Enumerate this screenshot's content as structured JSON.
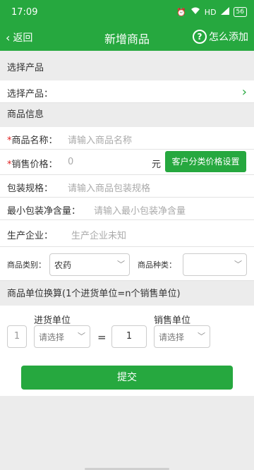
{
  "status_bar": {
    "time": "17:09",
    "net": "HD",
    "battery": "56"
  },
  "header": {
    "back_label": "返回",
    "title": "新增商品",
    "help_label": "怎么添加"
  },
  "sections": {
    "select_product": "选择产品",
    "product_info": "商品信息",
    "unit_conversion": "商品单位换算(1个进货单位=n个销售单位)"
  },
  "select_product_row": {
    "label": "选择产品："
  },
  "fields": {
    "name": {
      "required": "*",
      "label": "商品名称：",
      "placeholder": "请输入商品名称"
    },
    "price": {
      "required": "*",
      "label": "销售价格：",
      "placeholder": "0",
      "unit": "元",
      "button": "客户分类价格设置"
    },
    "spec": {
      "label": "包装规格：",
      "placeholder": "请输入商品包装规格"
    },
    "min_pack": {
      "label": "最小包装净含量：",
      "placeholder": "请输入最小包装净含量"
    },
    "producer": {
      "label": "生产企业：",
      "placeholder": "生产企业未知"
    },
    "category": {
      "label": "商品类别：",
      "value": "农药"
    },
    "kind": {
      "label": "商品种类：",
      "value": ""
    }
  },
  "units": {
    "purchase_label": "进货单位",
    "sale_label": "销售单位",
    "purchase_qty": "1",
    "purchase_select": "请选择",
    "equals": "=",
    "sale_qty": "1",
    "sale_select": "请选择"
  },
  "submit_label": "提交",
  "colors": {
    "accent": "#26a83f",
    "required": "#e02020"
  }
}
